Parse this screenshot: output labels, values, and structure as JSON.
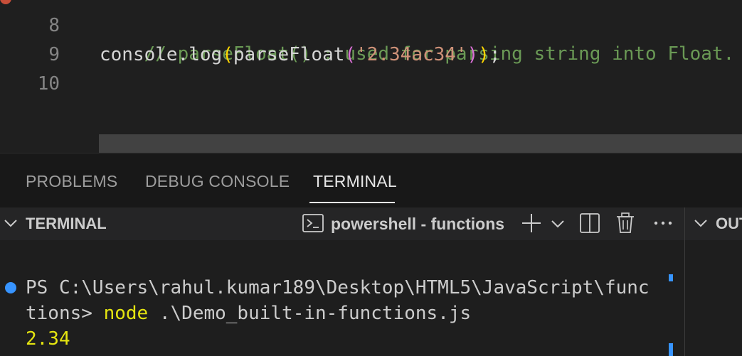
{
  "editor": {
    "line_numbers": [
      "8",
      "9",
      "10"
    ],
    "line8_comment": "// parseFloat() : used for parsing string into Float.",
    "line9": {
      "prefix": "console.log",
      "open1": "(",
      "fn": "parseFloat",
      "open2": "(",
      "str": "'2.34ac34'",
      "close2": ")",
      "close1": ")",
      "end": ";"
    }
  },
  "panel": {
    "tabs": [
      {
        "label": "PROBLEMS"
      },
      {
        "label": "DEBUG CONSOLE"
      },
      {
        "label": "TERMINAL"
      }
    ],
    "active_tab": "TERMINAL"
  },
  "terminal": {
    "section_title": "TERMINAL",
    "instance_label": "powershell - functions",
    "other_section_title": "OUT",
    "lines": {
      "prompt1": "PS C:\\Users\\rahul.kumar189\\Desktop\\HTML5\\JavaScript\\func",
      "prompt2_prefix": "tions> ",
      "cmd": "node",
      "args": " .\\Demo_built-in-functions.js",
      "output": "2.34"
    }
  },
  "icons": {
    "section_chevron": "chevron-down-icon",
    "instance": "terminal-icon",
    "add": "plus-icon",
    "add_menu": "chevron-down-icon",
    "split": "split-editor-icon",
    "kill": "trash-icon",
    "more": "ellipsis-icon"
  },
  "colors": {
    "comment": "#6a9955",
    "string": "#ce9178",
    "brace1": "#ffd700",
    "brace2": "#da70d6",
    "terminal_yellow": "#e5e510",
    "accent_blue": "#3794ff"
  }
}
